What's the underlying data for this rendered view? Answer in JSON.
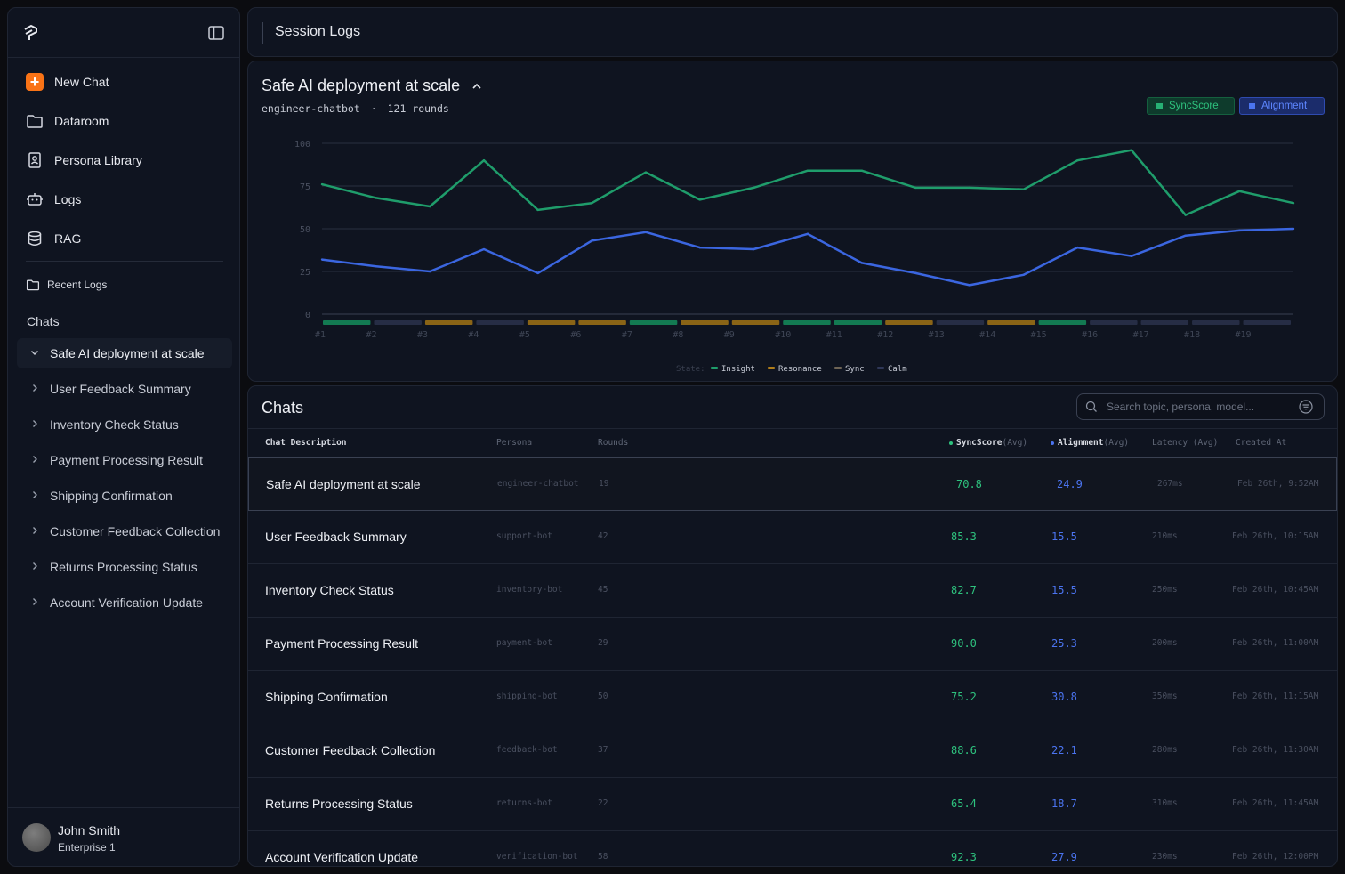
{
  "sidebar": {
    "nav": [
      {
        "label": "New Chat",
        "icon": "plus-icon"
      },
      {
        "label": "Dataroom",
        "icon": "folder-icon"
      },
      {
        "label": "Persona Library",
        "icon": "id-badge-icon"
      },
      {
        "label": "Logs",
        "icon": "robot-icon"
      },
      {
        "label": "RAG",
        "icon": "database-icon"
      }
    ],
    "recent_logs": "Recent Logs",
    "chats_label": "Chats",
    "chats": [
      "Safe AI deployment at scale",
      "User Feedback Summary",
      "Inventory Check Status",
      "Payment Processing Result",
      "Shipping Confirmation",
      "Customer Feedback Collection",
      "Returns Processing Status",
      "Account Verification Update"
    ],
    "user": {
      "name": "John Smith",
      "plan": "Enterprise 1"
    }
  },
  "header": {
    "title": "Session Logs"
  },
  "chart_panel": {
    "title": "Safe AI deployment at scale",
    "persona": "engineer-chatbot",
    "separator": "·",
    "rounds": "121 rounds",
    "legend_sync": "SyncScore",
    "legend_align": "Alignment",
    "state_legend": {
      "label": "State:",
      "items": [
        "Insight",
        "Resonance",
        "Sync",
        "Calm"
      ]
    }
  },
  "chart_data": {
    "type": "line",
    "ylim": [
      0,
      100
    ],
    "yticks": [
      "100",
      "75",
      "50",
      "25",
      "0"
    ],
    "x": [
      "#1",
      "#2",
      "#3",
      "#4",
      "#5",
      "#6",
      "#7",
      "#8",
      "#9",
      "#10",
      "#11",
      "#12",
      "#13",
      "#14",
      "#15",
      "#16",
      "#17",
      "#18",
      "#19"
    ],
    "series": [
      {
        "name": "SyncScore",
        "color": "#1f9d6b",
        "values": [
          76,
          68,
          63,
          90,
          61,
          65,
          83,
          67,
          74,
          84,
          84,
          74,
          74,
          73,
          90,
          96,
          58,
          72,
          65
        ]
      },
      {
        "name": "Alignment",
        "color": "#3b66e0",
        "values": [
          32,
          28,
          25,
          38,
          24,
          43,
          48,
          39,
          38,
          47,
          30,
          24,
          17,
          23,
          39,
          34,
          46,
          49,
          50
        ]
      }
    ],
    "states": [
      "Insight",
      "Calm",
      "Resonance",
      "Calm",
      "Resonance",
      "Resonance",
      "Insight",
      "Resonance",
      "Resonance",
      "Insight",
      "Insight",
      "Resonance",
      "Calm",
      "Resonance",
      "Insight",
      "Calm",
      "Calm",
      "Calm",
      "Calm"
    ],
    "state_colors": {
      "Insight": "#137a52",
      "Resonance": "#8a6416",
      "Sync": "#5f5548",
      "Calm": "#262d45"
    }
  },
  "table": {
    "title": "Chats",
    "search_placeholder": "Search topic, persona, model...",
    "headers": {
      "desc": "Chat Description",
      "persona": "Persona",
      "rounds": "Rounds",
      "sync": "SyncScore",
      "align": "Alignment",
      "avg": "(Avg)",
      "latency": "Latency (Avg)",
      "created": "Created At"
    },
    "rows": [
      {
        "desc": "Safe AI deployment at scale",
        "persona": "engineer-chatbot",
        "rounds": "19",
        "sync": "70.8",
        "align": "24.9",
        "latency": "267ms",
        "created": "Feb 26th, 9:52AM"
      },
      {
        "desc": "User Feedback Summary",
        "persona": "support-bot",
        "rounds": "42",
        "sync": "85.3",
        "align": "15.5",
        "latency": "210ms",
        "created": "Feb 26th, 10:15AM"
      },
      {
        "desc": "Inventory Check Status",
        "persona": "inventory-bot",
        "rounds": "45",
        "sync": "82.7",
        "align": "15.5",
        "latency": "250ms",
        "created": "Feb 26th, 10:45AM"
      },
      {
        "desc": "Payment Processing Result",
        "persona": "payment-bot",
        "rounds": "29",
        "sync": "90.0",
        "align": "25.3",
        "latency": "200ms",
        "created": "Feb 26th, 11:00AM"
      },
      {
        "desc": "Shipping Confirmation",
        "persona": "shipping-bot",
        "rounds": "50",
        "sync": "75.2",
        "align": "30.8",
        "latency": "350ms",
        "created": "Feb 26th, 11:15AM"
      },
      {
        "desc": "Customer Feedback Collection",
        "persona": "feedback-bot",
        "rounds": "37",
        "sync": "88.6",
        "align": "22.1",
        "latency": "280ms",
        "created": "Feb 26th, 11:30AM"
      },
      {
        "desc": "Returns Processing Status",
        "persona": "returns-bot",
        "rounds": "22",
        "sync": "65.4",
        "align": "18.7",
        "latency": "310ms",
        "created": "Feb 26th, 11:45AM"
      },
      {
        "desc": "Account Verification Update",
        "persona": "verification-bot",
        "rounds": "58",
        "sync": "92.3",
        "align": "27.9",
        "latency": "230ms",
        "created": "Feb 26th, 12:00PM"
      }
    ]
  }
}
